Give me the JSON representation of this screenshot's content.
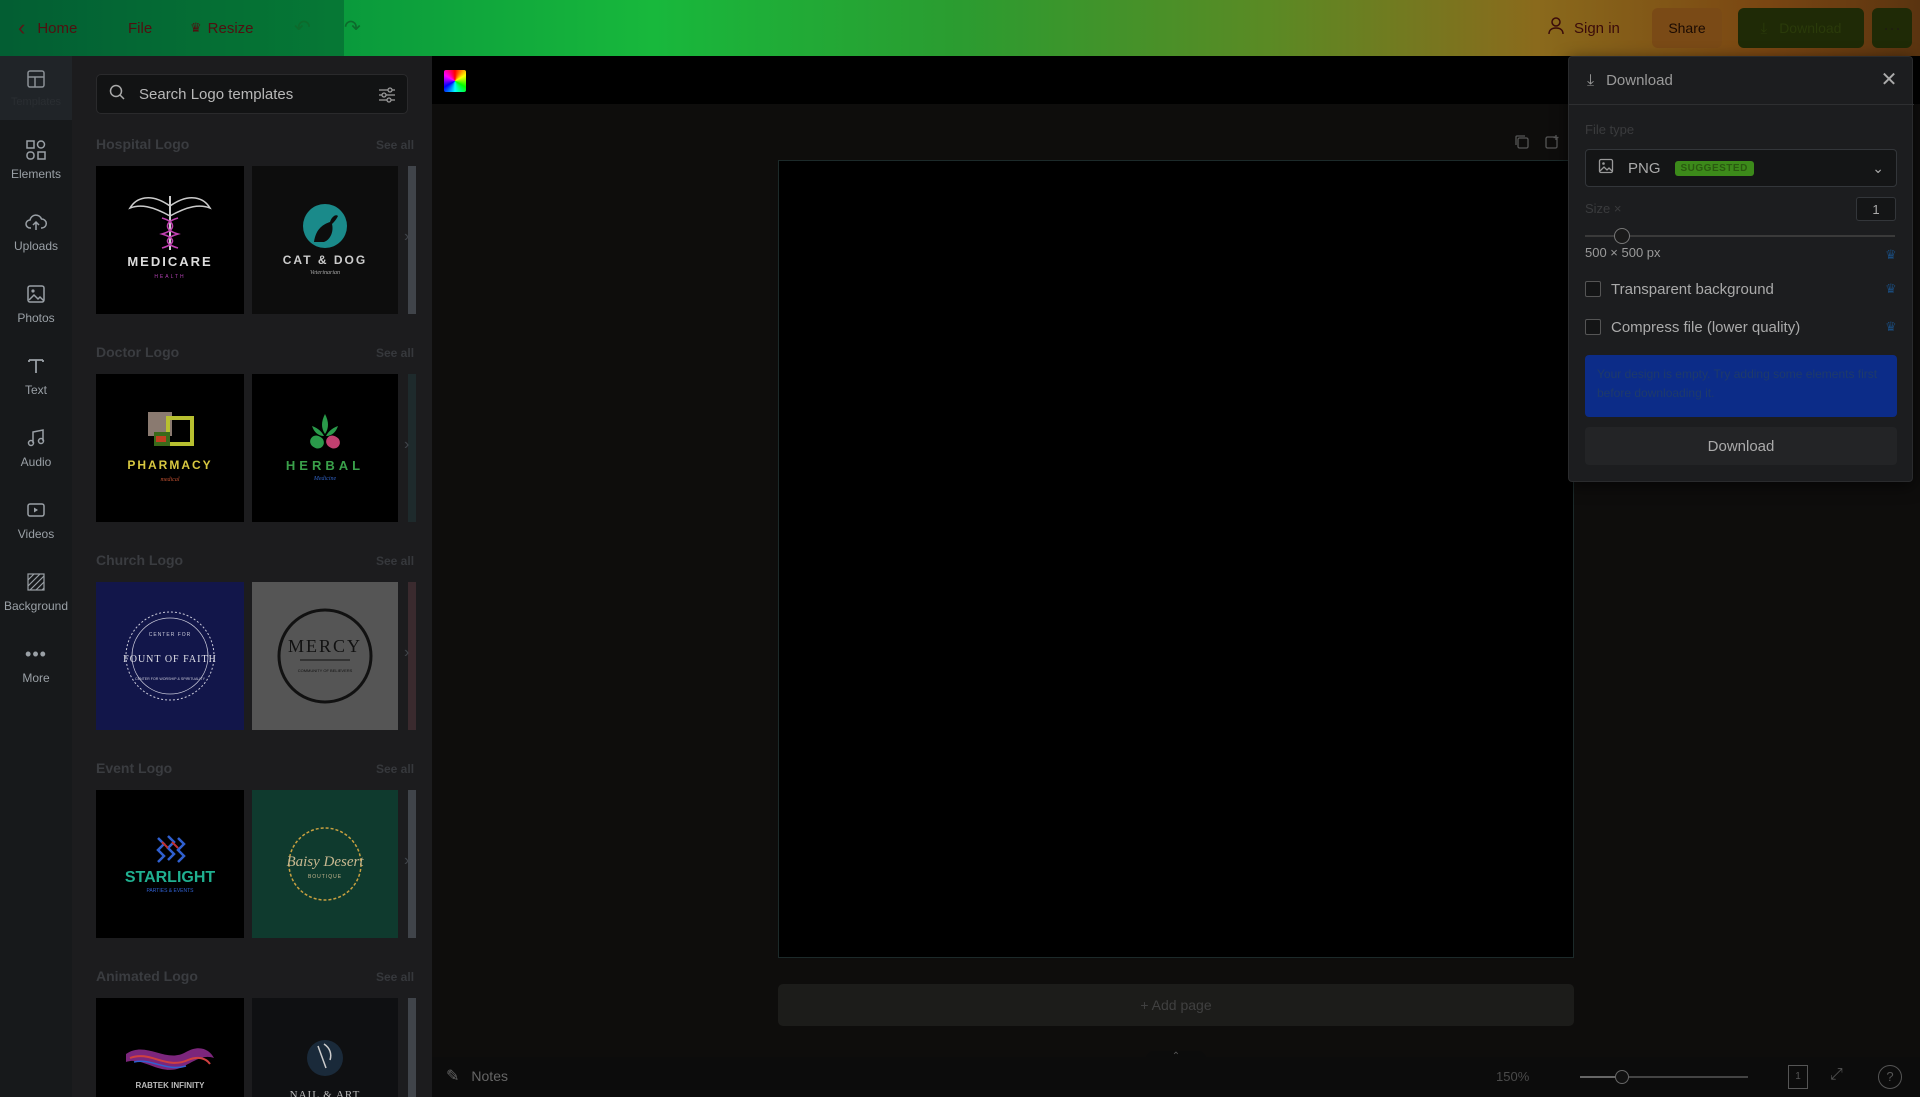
{
  "topbar": {
    "home_label": "Home",
    "file_label": "File",
    "resize_label": "Resize",
    "signin_label": "Sign in",
    "share_label": "Share",
    "download_label": "Download",
    "more_icon": "more-horizontal-icon"
  },
  "rail": {
    "items": [
      {
        "label": "Templates",
        "icon": "templates-icon"
      },
      {
        "label": "Elements",
        "icon": "elements-icon"
      },
      {
        "label": "Uploads",
        "icon": "upload-cloud-icon"
      },
      {
        "label": "Photos",
        "icon": "photo-icon"
      },
      {
        "label": "Text",
        "icon": "text-icon"
      },
      {
        "label": "Audio",
        "icon": "music-note-icon"
      },
      {
        "label": "Videos",
        "icon": "video-icon"
      },
      {
        "label": "Background",
        "icon": "background-icon"
      },
      {
        "label": "More",
        "icon": "more-dots-icon"
      }
    ]
  },
  "panel": {
    "search_placeholder": "Search Logo templates",
    "see_all": "See all",
    "sections": [
      {
        "title": "Hospital Logo",
        "thumbs": [
          {
            "line1": "MEDICARE",
            "line2": "HEALTH"
          },
          {
            "line1": "CAT & DOG",
            "line2": "Veterinarian"
          }
        ]
      },
      {
        "title": "Doctor Logo",
        "thumbs": [
          {
            "line1": "PHARMACY",
            "line2": "medical"
          },
          {
            "line1": "HERBAL",
            "line2": "Medicine"
          }
        ]
      },
      {
        "title": "Church Logo",
        "thumbs": [
          {
            "line1": "FOUNT OF FAITH",
            "line2": "CENTER FOR WORSHIP & SPIRITUALITY"
          },
          {
            "line1": "MERCY",
            "line2": "COMMUNITY OF BELIEVERS"
          }
        ]
      },
      {
        "title": "Event Logo",
        "thumbs": [
          {
            "line1": "STARLIGHT",
            "line2": "PARTIES & EVENTS"
          },
          {
            "line1": "Baisy Desert",
            "line2": "BOUTIQUE"
          }
        ]
      },
      {
        "title": "Animated Logo",
        "thumbs": [
          {
            "line1": "RABTEK INFINITY",
            "line2": ""
          },
          {
            "line1": "NAIL & ART",
            "line2": ""
          }
        ]
      }
    ]
  },
  "editor": {
    "add_page_label": "+ Add page",
    "notes_label": "Notes",
    "zoom_label": "150%",
    "zoom_fraction": 0.25,
    "page_number": "1",
    "help_label": "?"
  },
  "download_panel": {
    "title": "Download",
    "file_type_label": "File type",
    "file_type_value": "PNG",
    "suggested_badge": "SUGGESTED",
    "size_label": "Size ×",
    "size_value": "1",
    "size_fraction": 0.12,
    "dimensions": "500 × 500 px",
    "transparent_label": "Transparent background",
    "compress_label": "Compress file (lower quality)",
    "empty_notice": "Your design is empty. Try adding some elements first before downloading it.",
    "download_button": "Download"
  }
}
